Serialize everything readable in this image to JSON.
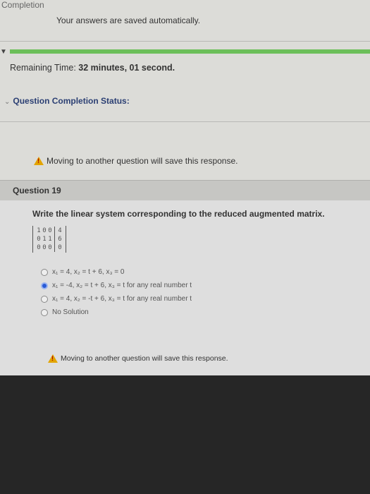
{
  "header": {
    "completion_label": "Completion",
    "autosave_text": "Your answers are saved automatically."
  },
  "progress": {
    "fraction": 1.0,
    "color": "#6cbf5a"
  },
  "timer": {
    "label": "Remaining Time:",
    "value": "32 minutes, 01 second."
  },
  "status": {
    "label": "Question Completion Status:"
  },
  "warning": {
    "text": "Moving to another question will save this response."
  },
  "question": {
    "title": "Question 19",
    "prompt": "Write the linear system corresponding to the reduced augmented matrix.",
    "matrix": [
      [
        "1",
        "0",
        "0",
        "4"
      ],
      [
        "0",
        "1",
        "1",
        "6"
      ],
      [
        "0",
        "0",
        "0",
        "0"
      ]
    ],
    "options": [
      {
        "text": "x₁ = 4, x₂ = t + 6, x₃ = 0",
        "selected": false
      },
      {
        "text": "x₁ = -4, x₂ = t + 6, x₃ = t for any real number t",
        "selected": true
      },
      {
        "text": "x₁ = 4, x₂ = -t + 6, x₃ = t for any real number t",
        "selected": false
      },
      {
        "text": "No Solution",
        "selected": false
      }
    ]
  }
}
